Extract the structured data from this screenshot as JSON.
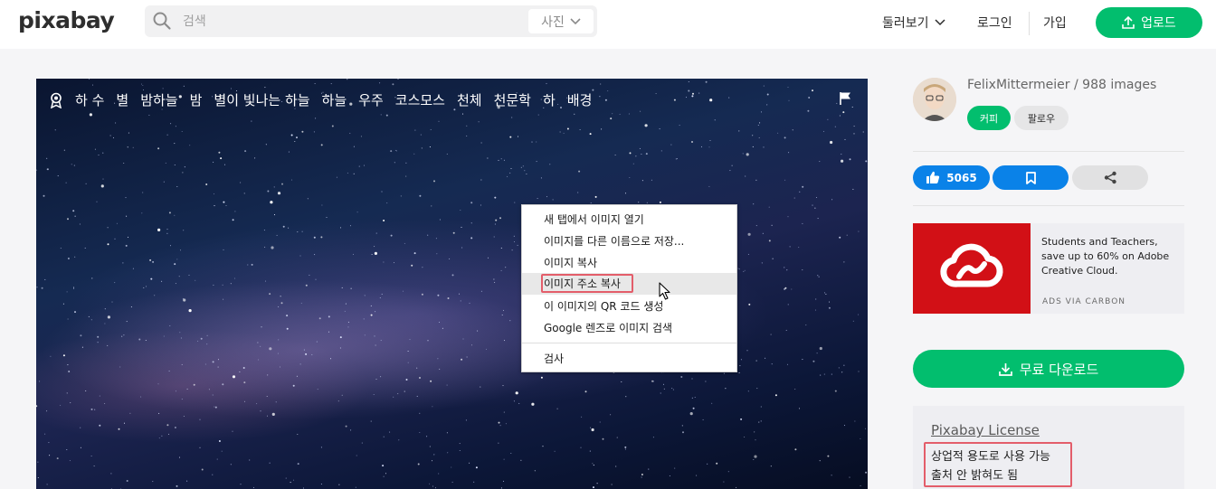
{
  "header": {
    "logo": "pixabay",
    "search_placeholder": "검색",
    "search_type": "사진",
    "nav_explore": "둘러보기",
    "nav_login": "로그인",
    "nav_join": "가입",
    "upload_label": "업로드"
  },
  "image": {
    "tags": [
      "하 수",
      "별",
      "밤하늘",
      "밤",
      "별이 빛나는 하늘",
      "하늘",
      "우주",
      "코스모스",
      "천체",
      "천문학",
      "하",
      "배경"
    ]
  },
  "context_menu": {
    "items": [
      "새 탭에서 이미지 열기",
      "이미지를 다른 이름으로 저장...",
      "이미지 복사",
      "이미지 주소 복사",
      "이 이미지의 QR 코드 생성",
      "Google 렌즈로 이미지 검색",
      "검사"
    ],
    "highlighted_index": 3
  },
  "sidebar": {
    "author": "FelixMittermeier / 988 images",
    "coffee_label": "커피",
    "follow_label": "팔로우",
    "likes": "5065",
    "ad": {
      "text": "Students and Teachers, save up to 60% on Adobe Creative Cloud.",
      "via": "ADS VIA CARBON"
    },
    "download_label": "무료 다운로드",
    "license": {
      "title": "Pixabay License",
      "lines": [
        "상업적 용도로 사용 가능",
        "출처 안 밝혀도 됨"
      ]
    }
  },
  "colors": {
    "brand_green": "#02be6e",
    "action_blue": "#0a82e8",
    "highlight_red": "#e35d6a",
    "adobe_red": "#d21016"
  }
}
